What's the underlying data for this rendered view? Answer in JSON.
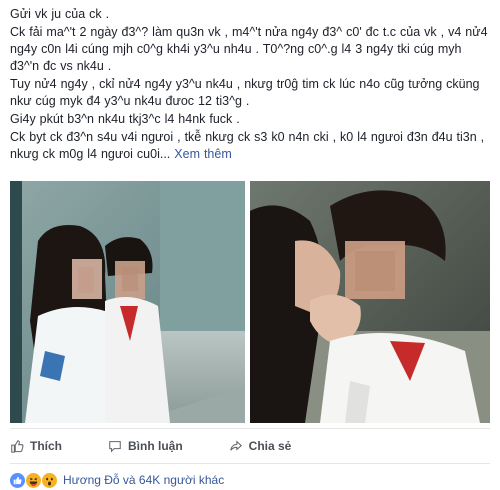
{
  "post": {
    "lines": [
      "Gửi vk ju của ck .",
      "Ck fải ma^'t 2 ngày đ3^? làm qu3n vk , m4^'t nửa ng4y đ3^ c0' đc t.c của vk , v4 nử4 ng4y c0n l4i cúng mjh c0^g kh4i y3^u nh4u . T0^?ng c0^.g l4 3 ng4y tki cúg myh đ3^'n đc vs nk4u .",
      "Tuy nử4 ng4y , ckỉ nử4 ng4y y3^u nk4u , nkưg tr0ĝ tim ck lúc n4o cũg tưởng cküng nkư cúg myk đ4 y3^u nk4u đưoc 12 ti3^g .",
      "Gi4y pkút b3^n nk4u tkj3^c l4 h4nk fuck .",
      "Ck byt ck đ3^n s4u v4i ngưoi , tkễ nkưg ck s3 k0 n4n cki , k0 l4 ngưoi đ3n đ4u ti3n , nkưg ck m0g l4 ngưoi cu0i..."
    ],
    "see_more": "Xem thêm"
  },
  "photos": {
    "left_label": "photo-left",
    "right_label": "photo-right"
  },
  "actions": {
    "like": "Thích",
    "comment": "Bình luận",
    "share": "Chia sẻ"
  },
  "reactions": {
    "summary": "Hương Đỗ và 64K người khác",
    "types": [
      "like-icon",
      "haha-icon",
      "wow-icon"
    ]
  },
  "colors": {
    "link": "#365899",
    "text": "#1d2129",
    "action_text": "#4b4f56",
    "like_blue": "#5890ff",
    "haha_yellow": "#f7b125"
  }
}
